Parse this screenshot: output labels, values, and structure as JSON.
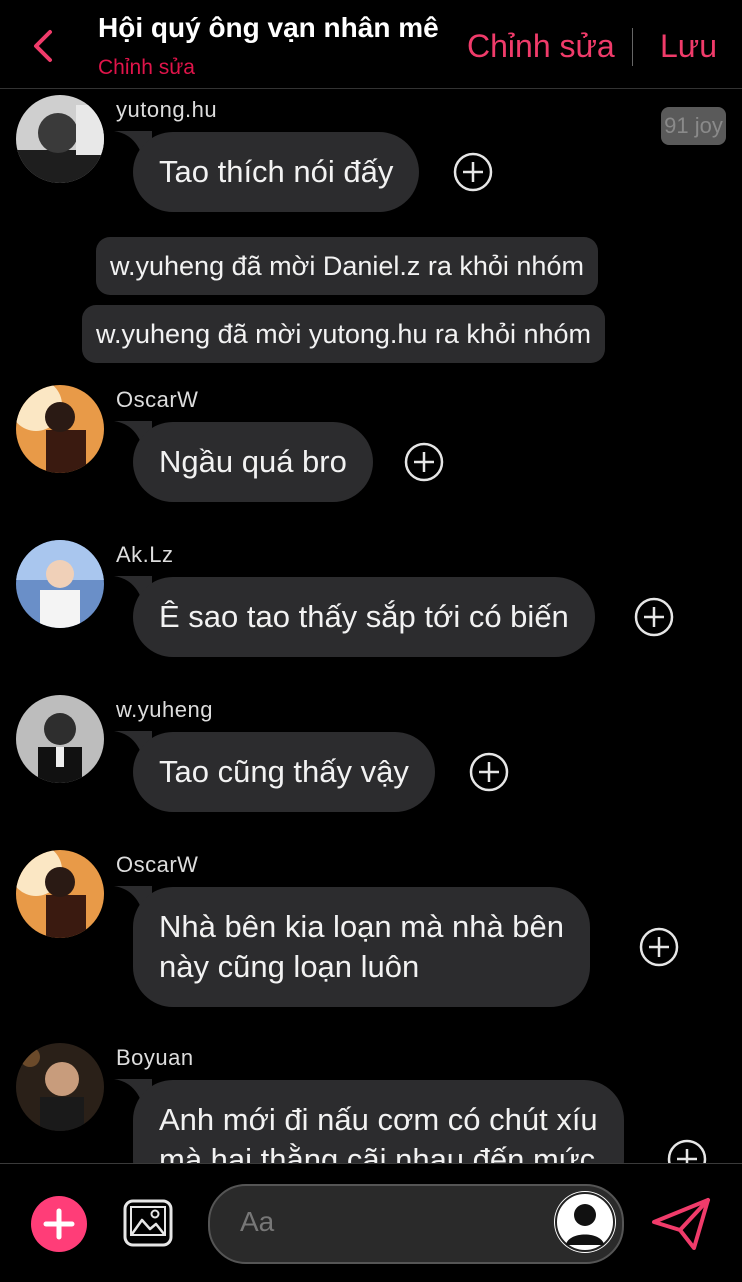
{
  "header": {
    "title": "Hội quý ông vạn nhân mê",
    "subtitle": "Chỉnh sửa",
    "edit_label": "Chỉnh sửa",
    "save_label": "Lưu",
    "back_icon": "chevron-left-icon",
    "accent_color": "#f03b6a"
  },
  "chat": {
    "badge": "91 joy",
    "messages": [
      {
        "type": "user",
        "username": "yutong.hu",
        "text": "Tao thích nói đấy",
        "avatar_icon": "user-avatar"
      },
      {
        "type": "system",
        "text": "w.yuheng đã mời Daniel.z ra khỏi nhóm"
      },
      {
        "type": "system",
        "text": "w.yuheng đã mời yutong.hu ra khỏi nhóm"
      },
      {
        "type": "user",
        "username": "OscarW",
        "text": "Ngầu quá bro",
        "avatar_icon": "user-avatar"
      },
      {
        "type": "user",
        "username": "Ak.Lz",
        "text": "Ê sao tao thấy sắp tới có biến",
        "avatar_icon": "user-avatar"
      },
      {
        "type": "user",
        "username": "w.yuheng",
        "text": "Tao cũng thấy vậy",
        "avatar_icon": "user-avatar"
      },
      {
        "type": "user",
        "username": "OscarW",
        "text_line1": "Nhà bên kia loạn mà nhà bên",
        "text_line2": "này cũng loạn luôn",
        "avatar_icon": "user-avatar"
      },
      {
        "type": "user",
        "username": "Boyuan",
        "text_line1": "Anh mới đi nấu cơm có chút xíu",
        "text_line2": "mà hai thằng cãi nhau đến mức",
        "avatar_icon": "user-avatar"
      }
    ]
  },
  "composer": {
    "placeholder": "Aa",
    "add_icon": "plus-icon",
    "gallery_icon": "image-icon",
    "send_icon": "send-icon",
    "add_color": "#ff3d78"
  }
}
